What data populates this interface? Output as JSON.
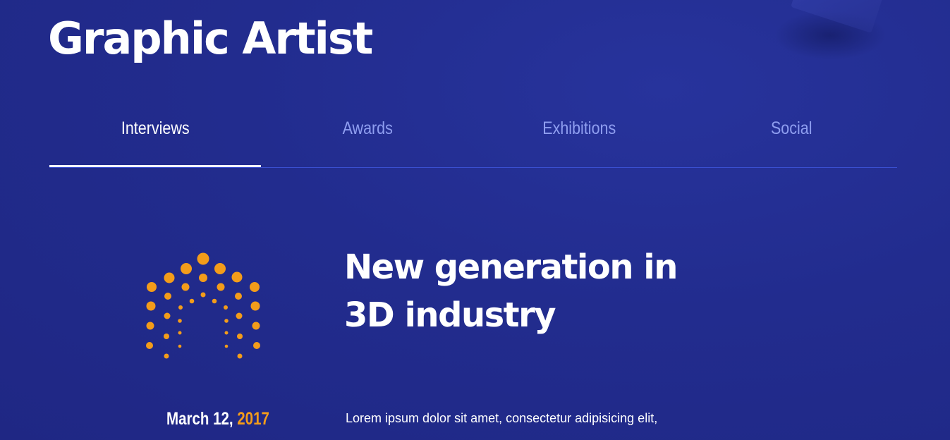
{
  "header": {
    "title": "Graphic Artist"
  },
  "tabs": [
    {
      "label": "Interviews",
      "active": true
    },
    {
      "label": "Awards",
      "active": false
    },
    {
      "label": "Exhibitions",
      "active": false
    },
    {
      "label": "Social",
      "active": false
    }
  ],
  "article": {
    "title_line1": "New generation in",
    "title_line2": "3D industry",
    "date_day": "March 12,",
    "date_year": "2017",
    "excerpt": "Lorem ipsum dolor sit amet, consectetur adipisicing elit,"
  },
  "colors": {
    "background": "#222c8e",
    "accent": "#f39c1a",
    "tab_inactive": "#8f9ef0",
    "divider": "#3a4fd0",
    "text": "#ffffff"
  },
  "icons": {
    "logo": "dotted-arch-logo-icon"
  }
}
